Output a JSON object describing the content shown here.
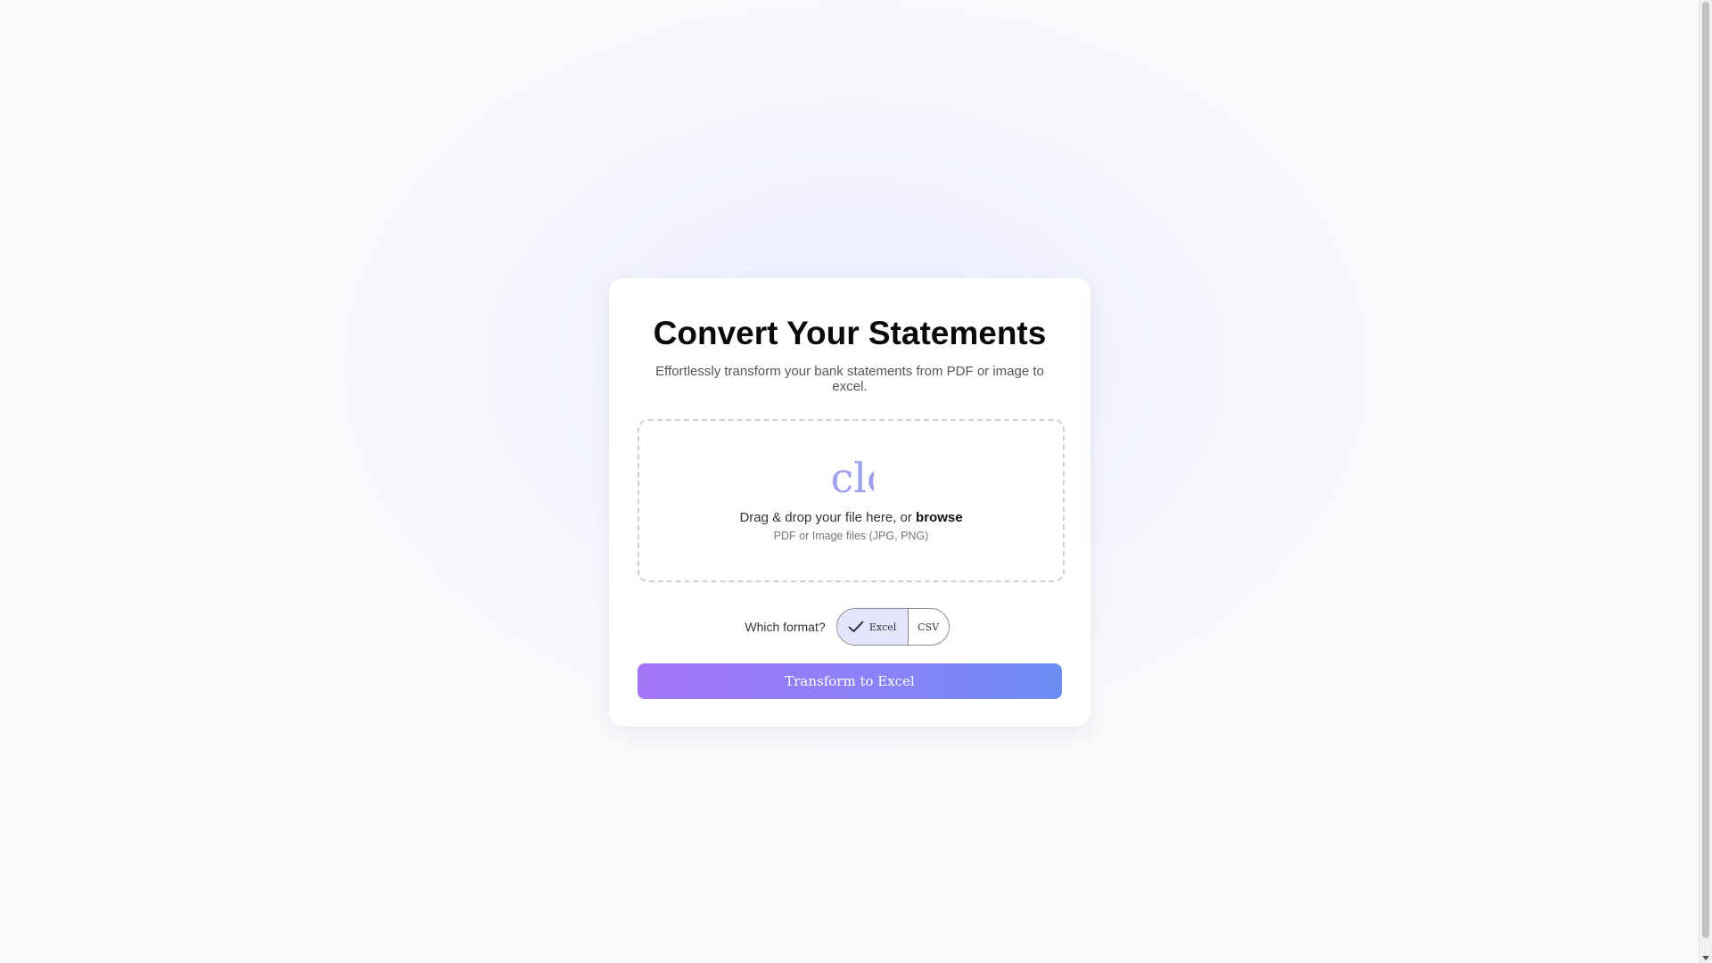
{
  "card": {
    "title": "Convert Your Statements",
    "subtitle": "Effortlessly transform your bank statements from PDF or image to excel."
  },
  "dropzone": {
    "icon": "cloud_upload-icon",
    "icon_fallback_text": "cloud_upload",
    "text_prefix": "Drag & drop your file here, or ",
    "browse_label": "browse",
    "hint": "PDF or Image files (JPG, PNG)"
  },
  "format": {
    "label": "Which format?",
    "options": [
      {
        "label": "Excel",
        "selected": true
      },
      {
        "label": "CSV",
        "selected": false
      }
    ]
  },
  "action": {
    "transform_label": "Transform to Excel"
  },
  "colors": {
    "accent_start": "#a274f8",
    "accent_end": "#6c8cf6",
    "icon": "#9ea0ee",
    "selected_option_bg": "#e3e5fc"
  }
}
